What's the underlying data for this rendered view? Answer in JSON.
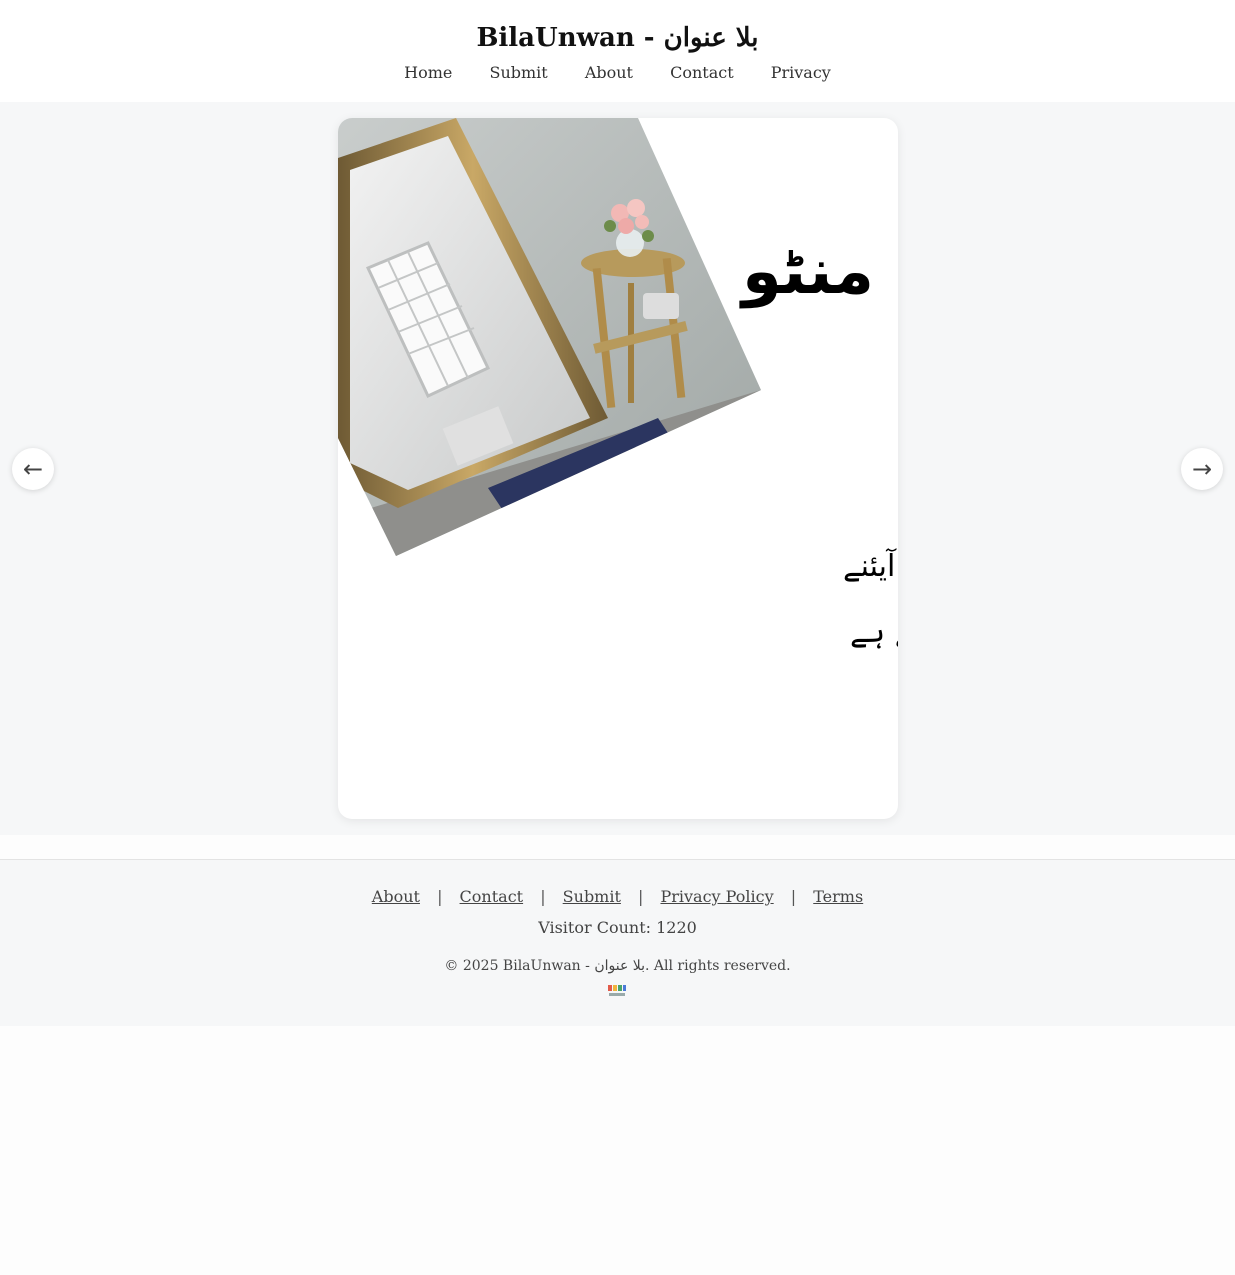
{
  "header": {
    "site_title": "BilaUnwan - بلا عنوان",
    "nav": [
      "Home",
      "Submit",
      "About",
      "Contact",
      "Privacy"
    ]
  },
  "slide": {
    "author_mark": "منٹو",
    "quote_line1": "میں اس معاشرے کا حصہ ہوں جہاں ہم آیئنے",
    "quote_line2": "کا سامنا صرف شکل دیکھنے کے لیے کرتے ہے"
  },
  "carousel": {
    "prev_icon": "←",
    "next_icon": "→"
  },
  "footer": {
    "links": [
      "About",
      "Contact",
      "Submit",
      "Privacy Policy",
      "Terms"
    ],
    "separator": "|",
    "visitor_count": "Visitor Count: 1220",
    "copyright": "© 2025 BilaUnwan - بلا عنوان. All rights reserved."
  },
  "colors": {
    "stage_bg": "#f6f7f8",
    "card_bg": "#ffffff",
    "text": "#333333"
  }
}
